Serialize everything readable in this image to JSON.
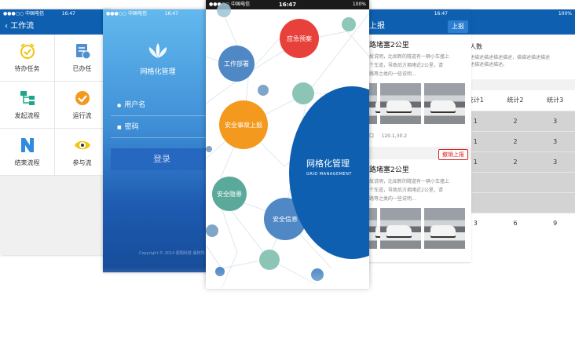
{
  "status": {
    "carrier": "●●●○○ 中国电信",
    "carrier_s1": "●●●○○ 中国电信",
    "time": "16:47",
    "battery": "100%"
  },
  "workflow": {
    "title": "工作流",
    "items": [
      "待办任务",
      "已办任",
      "发起流程",
      "运行流",
      "结束流程",
      "参与流"
    ]
  },
  "login": {
    "brand": "网格化管理",
    "username_label": "用户名",
    "password_label": "密码",
    "login_button": "登录",
    "copyright": "Copyright © 2014 振翔科技 版权所"
  },
  "home": {
    "bubbles": [
      "应急预案",
      "工作部署",
      "安全事故上报",
      "安全隐患",
      "安全信息"
    ],
    "brand_cn": "网格化管理",
    "brand_en": "GRID MANAGEMENT"
  },
  "report": {
    "title": "上报",
    "submit_button": "上报",
    "item_title": "路堵塞2公里",
    "desc_line1": "故说明，比如新的隧道有一辆小车撞上",
    "desc_line2": "个车道，导致后方拥堵近2公里，请",
    "desc_line3": "路等之类的一些说明...",
    "meta_place": "口",
    "meta_coord": "120.1,30.2",
    "cancel_button": "撤销上报"
  },
  "stats": {
    "title": "人数",
    "desc_line1": "述描述描述描述描述，描描述描述描述",
    "desc_line2": "述描述描述描述。",
    "headers": [
      "统计1",
      "统计2",
      "统计3"
    ],
    "rows": [
      [
        "1",
        "2",
        "3"
      ],
      [
        "1",
        "2",
        "3"
      ],
      [
        "1",
        "2",
        "3"
      ]
    ],
    "totals": [
      "3",
      "6",
      "9"
    ]
  },
  "colors": {
    "brand_blue": "#0e5fb0",
    "bubble_red": "#e8403a",
    "bubble_orange": "#f39a1e",
    "bubble_blue": "#4f88c4",
    "bubble_teal": "#5aa99a",
    "cancel_red": "#dd2222"
  }
}
